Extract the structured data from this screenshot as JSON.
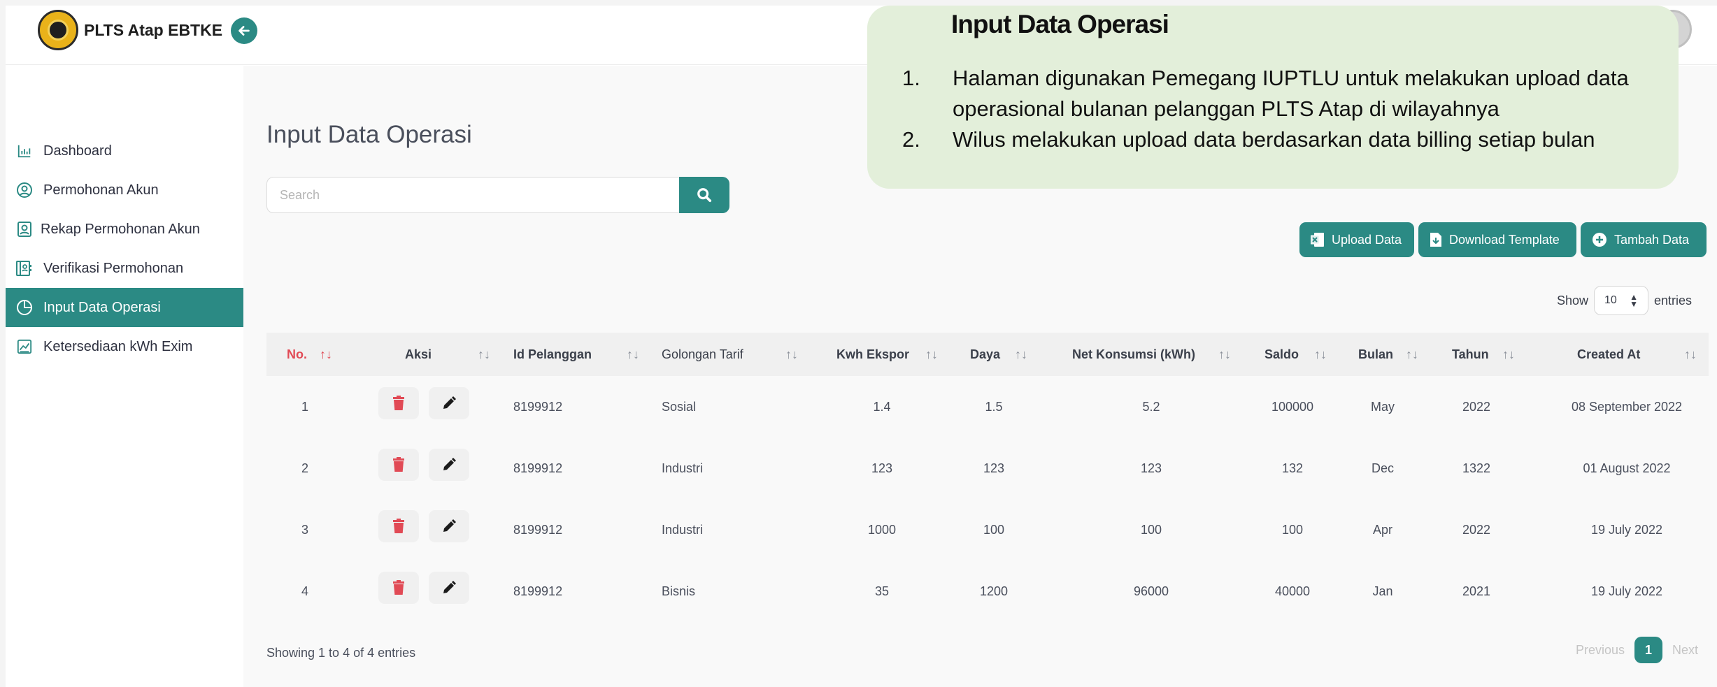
{
  "app": {
    "title": "PLTS Atap EBTKE"
  },
  "sidebar": {
    "items": [
      {
        "label": "Dashboard",
        "icon": "chart-bar-icon",
        "active": false
      },
      {
        "label": "Permohonan Akun",
        "icon": "user-circle-icon",
        "active": false
      },
      {
        "label": "Rekap Permohonan Akun",
        "icon": "user-square-icon",
        "active": false
      },
      {
        "label": "Verifikasi Permohonan",
        "icon": "contact-book-icon",
        "active": false
      },
      {
        "label": "Input Data Operasi",
        "icon": "pie-chart-icon",
        "active": true
      },
      {
        "label": "Ketersediaan kWh Exim",
        "icon": "chart-line-icon",
        "active": false
      }
    ]
  },
  "page": {
    "title": "Input Data Operasi",
    "search_placeholder": "Search"
  },
  "actions": {
    "upload": "Upload Data",
    "download": "Download Template",
    "add": "Tambah Data"
  },
  "entries": {
    "show": "Show",
    "value": "10",
    "suffix": "entries"
  },
  "table": {
    "columns": [
      "No.",
      "Aksi",
      "Id Pelanggan",
      "Golongan Tarif",
      "Kwh Ekspor",
      "Daya",
      "Net Konsumsi (kWh)",
      "Saldo",
      "Bulan",
      "Tahun",
      "Created At"
    ],
    "rows": [
      [
        "1",
        "8199912",
        "Sosial",
        "1.4",
        "1.5",
        "5.2",
        "100000",
        "May",
        "2022",
        "08 September 2022"
      ],
      [
        "2",
        "8199912",
        "Industri",
        "123",
        "123",
        "123",
        "132",
        "Dec",
        "1322",
        "01 August 2022"
      ],
      [
        "3",
        "8199912",
        "Industri",
        "1000",
        "100",
        "100",
        "100",
        "Apr",
        "2022",
        "19 July 2022"
      ],
      [
        "4",
        "8199912",
        "Bisnis",
        "35",
        "1200",
        "96000",
        "40000",
        "Jan",
        "2021",
        "19 July 2022"
      ]
    ]
  },
  "footer": {
    "info": "Showing 1 to 4 of 4 entries",
    "previous": "Previous",
    "page": "1",
    "next": "Next"
  },
  "callout": {
    "title": "Input Data Operasi",
    "items": [
      {
        "num": "1.",
        "text": "Halaman digunakan Pemegang IUPTLU untuk melakukan upload data operasional bulanan pelanggan PLTS Atap di wilayahnya"
      },
      {
        "num": "2.",
        "text": "Wilus melakukan upload data berdasarkan data billing setiap bulan"
      }
    ]
  },
  "colors": {
    "accent": "#2b8a84",
    "danger": "#e14a55",
    "callout_bg": "#e3efda"
  }
}
